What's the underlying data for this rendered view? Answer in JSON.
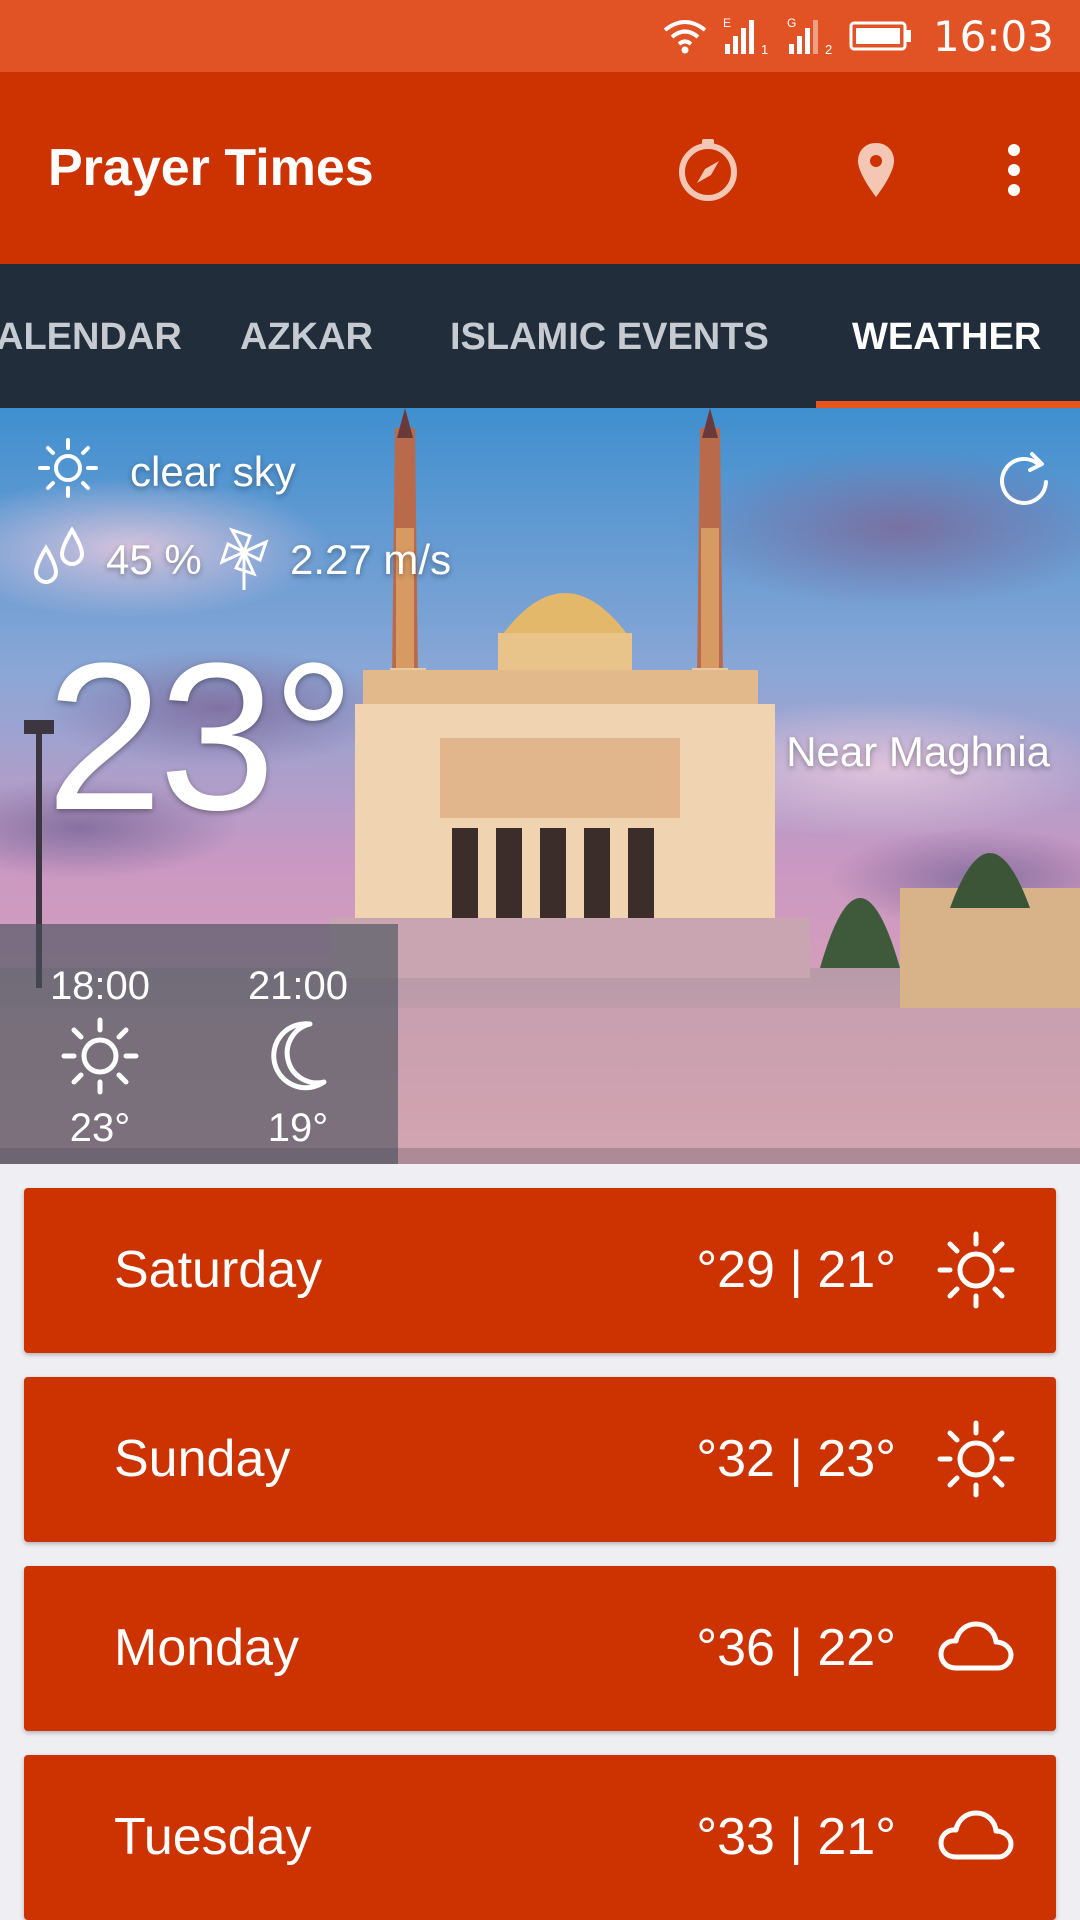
{
  "status_bar": {
    "time": "16:03",
    "icons": [
      "wifi-icon",
      "signal-1-icon",
      "signal-2-icon",
      "battery-icon"
    ],
    "signal_1_label": "E",
    "signal_2_label": "G",
    "sim_1": "1",
    "sim_2": "2"
  },
  "app_bar": {
    "title": "Prayer Times",
    "actions": [
      "compass-icon",
      "location-pin-icon",
      "more-vert-icon"
    ]
  },
  "tabs": [
    {
      "label": "ALENDAR",
      "active": false
    },
    {
      "label": "AZKAR",
      "active": false
    },
    {
      "label": "ISLAMIC EVENTS",
      "active": false
    },
    {
      "label": "WEATHER",
      "active": true
    }
  ],
  "weather": {
    "condition": "clear sky",
    "condition_icon": "sun-icon",
    "humidity": "45 %",
    "humidity_icon": "raindrops-icon",
    "wind": "2.27 m/s",
    "wind_icon": "pinwheel-icon",
    "temperature": "23°",
    "location": "Near Maghnia",
    "refresh_icon": "refresh-icon",
    "hourly": [
      {
        "time": "18:00",
        "icon": "sun-icon",
        "temp": "23°"
      },
      {
        "time": "21:00",
        "icon": "moon-icon",
        "temp": "19°"
      }
    ]
  },
  "forecast": [
    {
      "day": "Saturday",
      "temps": "°29 | 21°",
      "icon": "sun-icon"
    },
    {
      "day": "Sunday",
      "temps": "°32 | 23°",
      "icon": "sun-icon"
    },
    {
      "day": "Monday",
      "temps": "°36 | 22°",
      "icon": "cloud-icon"
    },
    {
      "day": "Tuesday",
      "temps": "°33 | 21°",
      "icon": "cloud-icon"
    }
  ],
  "colors": {
    "status_bar": "#e15324",
    "app_bar": "#cc3300",
    "tab_bar": "#222d3c",
    "tab_indicator": "#e8551c",
    "card": "#cc3300",
    "background": "#eeeef3"
  }
}
